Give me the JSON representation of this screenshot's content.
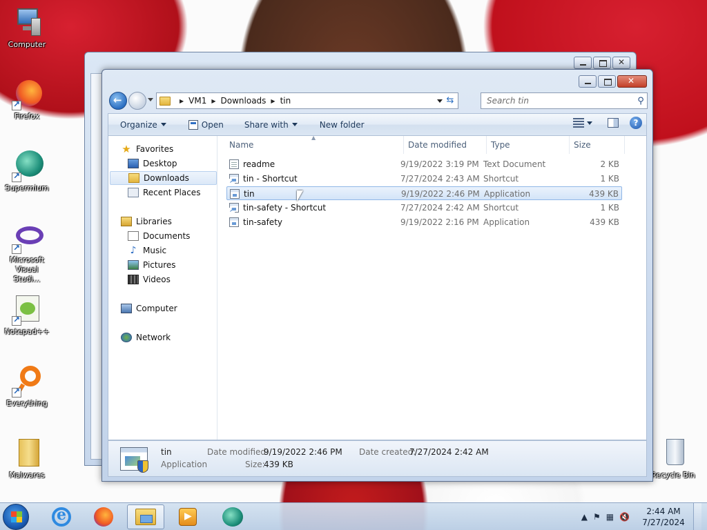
{
  "desktop": {
    "icons": [
      {
        "label": "Computer",
        "icon": "computer-icon"
      },
      {
        "label": "Firefox",
        "icon": "firefox-icon"
      },
      {
        "label": "Supermium",
        "icon": "supermium-icon"
      },
      {
        "label": "Microsoft Visual Studi...",
        "icon": "visual-studio-icon"
      },
      {
        "label": "Notepad++",
        "icon": "notepad-plus-plus-icon"
      },
      {
        "label": "Everything",
        "icon": "everything-icon"
      },
      {
        "label": "Malwares",
        "icon": "folder-icon"
      },
      {
        "label": "Recycle Bin",
        "icon": "recycle-bin-icon"
      }
    ]
  },
  "explorer": {
    "breadcrumb": [
      "VM1",
      "Downloads",
      "tin"
    ],
    "search_placeholder": "Search tin",
    "toolbar": {
      "organize": "Organize",
      "open": "Open",
      "share_with": "Share with",
      "new_folder": "New folder"
    },
    "nav": {
      "favorites": "Favorites",
      "desktop": "Desktop",
      "downloads": "Downloads",
      "recent_places": "Recent Places",
      "libraries": "Libraries",
      "documents": "Documents",
      "music": "Music",
      "pictures": "Pictures",
      "videos": "Videos",
      "computer": "Computer",
      "network": "Network"
    },
    "columns": {
      "name": "Name",
      "date_modified": "Date modified",
      "type": "Type",
      "size": "Size"
    },
    "files": [
      {
        "name": "readme",
        "date": "9/19/2022 3:19 PM",
        "type": "Text Document",
        "size": "2 KB",
        "icon": "document-icon"
      },
      {
        "name": "tin - Shortcut",
        "date": "7/27/2024 2:43 AM",
        "type": "Shortcut",
        "size": "1 KB",
        "icon": "shortcut-icon"
      },
      {
        "name": "tin",
        "date": "9/19/2022 2:46 PM",
        "type": "Application",
        "size": "439 KB",
        "icon": "application-icon"
      },
      {
        "name": "tin-safety - Shortcut",
        "date": "7/27/2024 2:42 AM",
        "type": "Shortcut",
        "size": "1 KB",
        "icon": "shortcut-icon"
      },
      {
        "name": "tin-safety",
        "date": "9/19/2022 2:16 PM",
        "type": "Application",
        "size": "439 KB",
        "icon": "application-icon"
      }
    ],
    "selected_index": 2,
    "details": {
      "name": "tin",
      "type": "Application",
      "date_modified_label": "Date modified:",
      "date_modified": "9/19/2022 2:46 PM",
      "date_created_label": "Date created:",
      "date_created": "7/27/2024 2:42 AM",
      "size_label": "Size:",
      "size": "439 KB"
    }
  },
  "taskbar": {
    "apps": [
      "internet-explorer-icon",
      "firefox-icon",
      "windows-explorer-icon",
      "media-player-icon",
      "supermium-icon"
    ],
    "clock_time": "2:44 AM",
    "clock_date": "7/27/2024"
  }
}
